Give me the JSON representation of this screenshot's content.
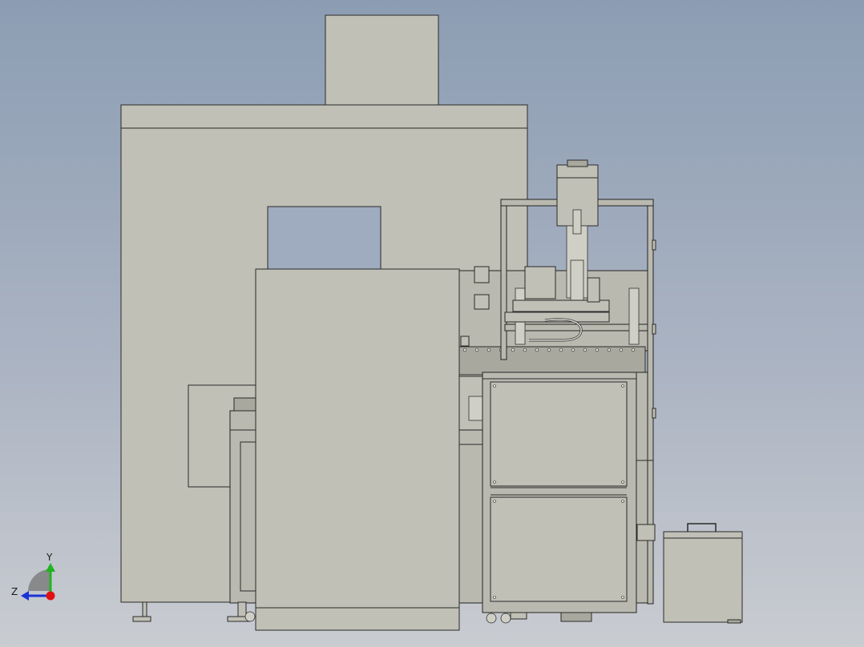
{
  "viewport": {
    "background_top": "#8c9db3",
    "background_bottom": "#c9ccd1",
    "model_color": "#c0c0b6"
  },
  "triad": {
    "y_label": "Y",
    "z_label": "Z",
    "y_color": "#1fb51f",
    "z_color": "#1a32d8",
    "x_color": "#e01010"
  }
}
